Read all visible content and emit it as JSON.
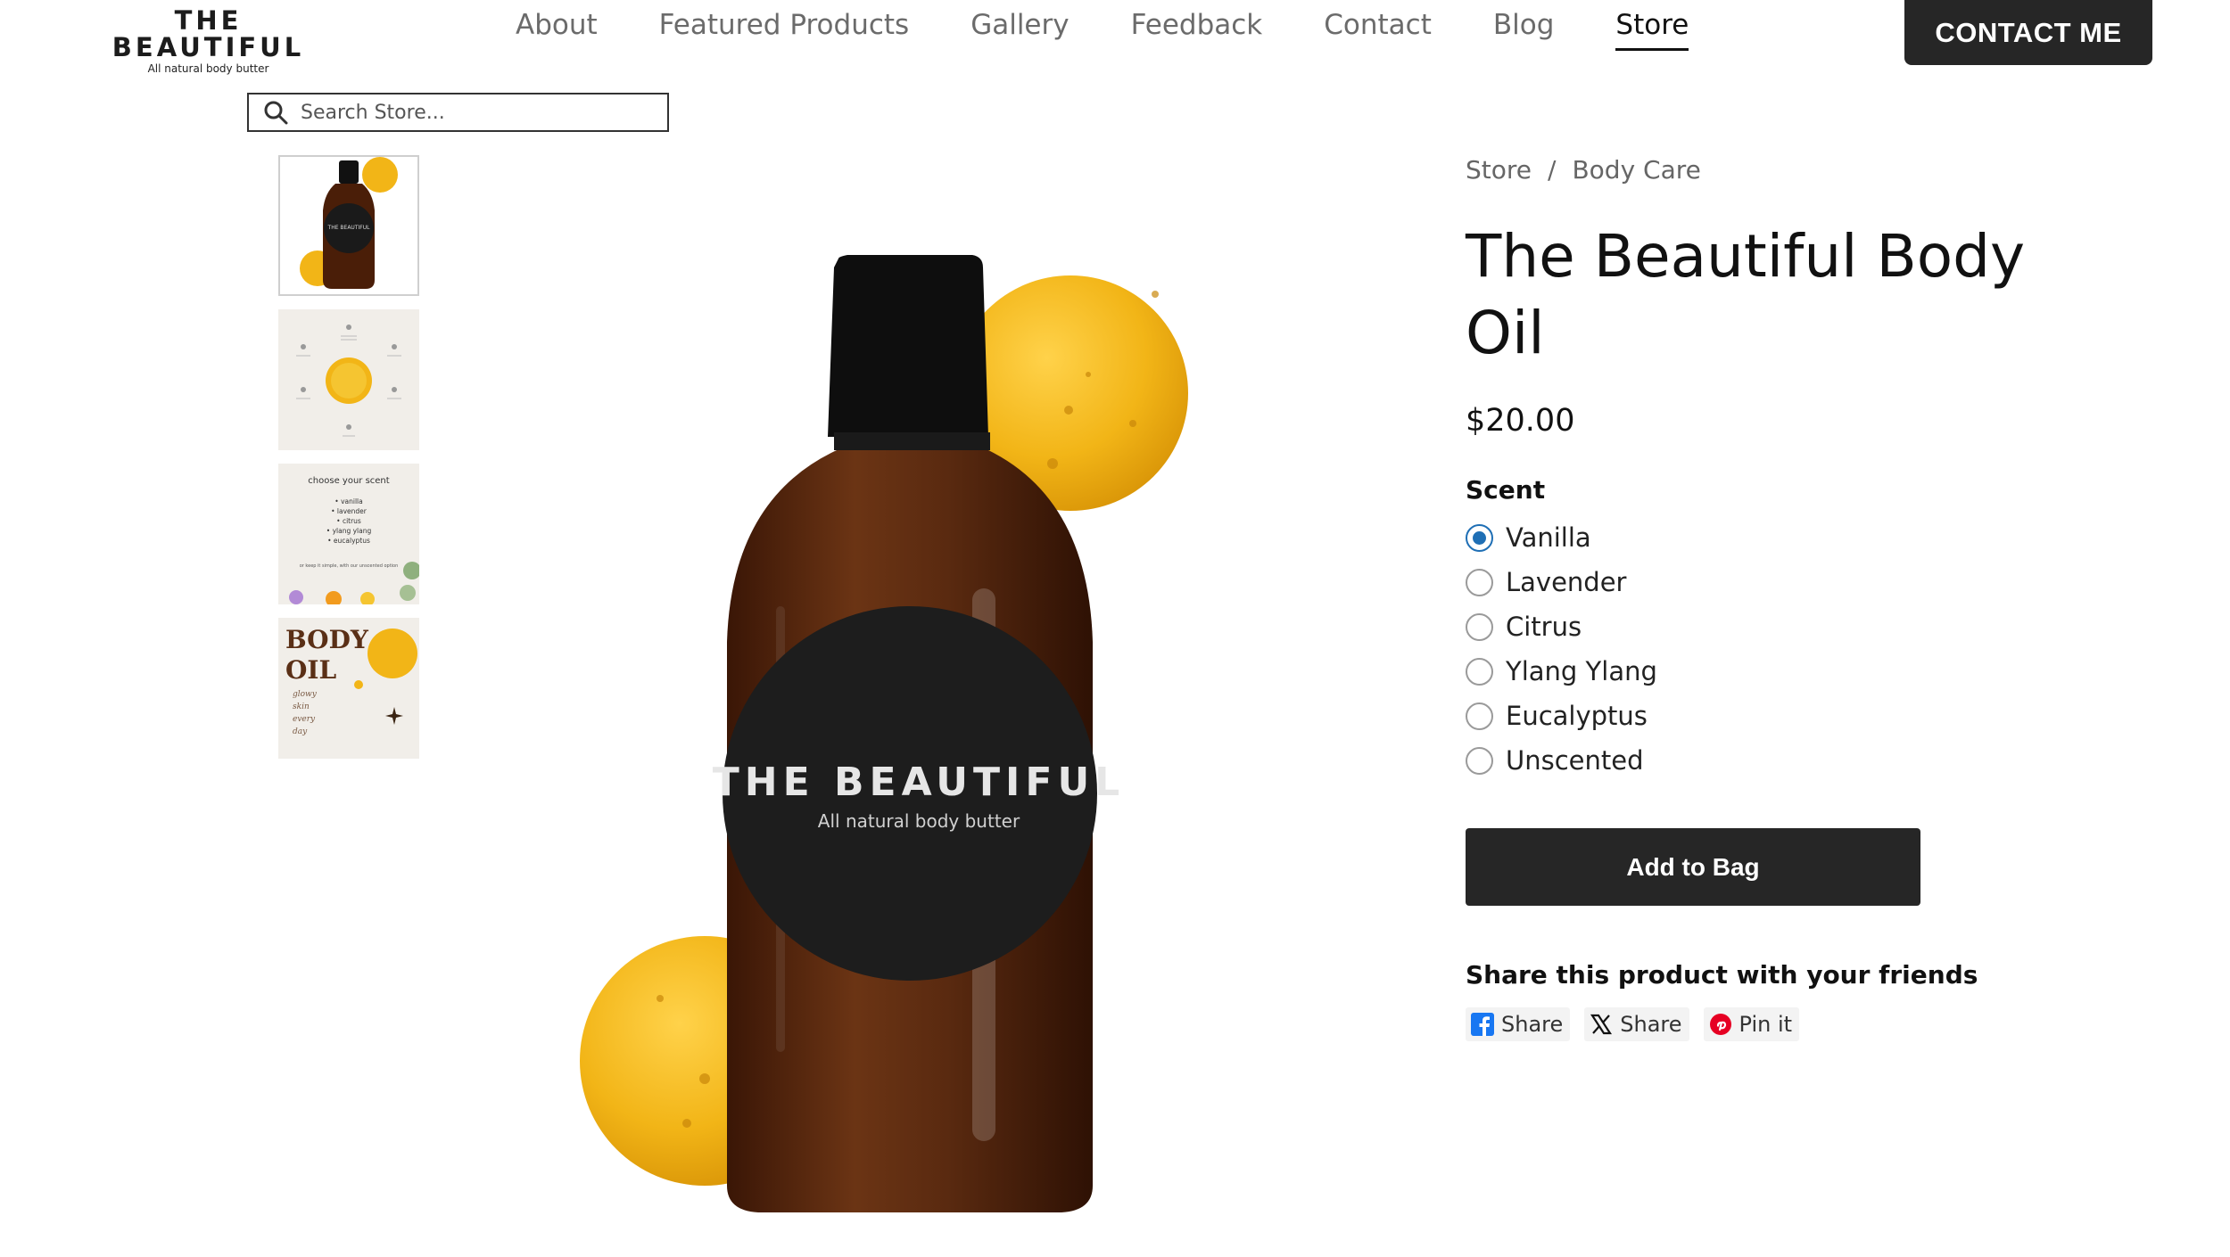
{
  "header": {
    "logo_title": "THE BEAUTIFUL",
    "logo_subtitle": "All natural body butter",
    "nav": [
      {
        "label": "About"
      },
      {
        "label": "Featured Products"
      },
      {
        "label": "Gallery"
      },
      {
        "label": "Feedback"
      },
      {
        "label": "Contact"
      },
      {
        "label": "Blog"
      },
      {
        "label": "Store",
        "active": true
      }
    ],
    "contact_button": "CONTACT ME"
  },
  "search": {
    "placeholder": "Search Store..."
  },
  "thumbnails": {
    "items": [
      {
        "label": "product-bottle-photo",
        "selected": true
      },
      {
        "label": "benefits-infographic"
      },
      {
        "label": "scent-options-card",
        "heading": "choose your scent",
        "lines": [
          "• vanilla",
          "• lavender",
          "• citrus",
          "• ylang ylang",
          "• eucalyptus"
        ],
        "footer": "or keep it simple, with our unscented option"
      },
      {
        "label": "body-oil-card",
        "line1": "BODY",
        "line2": "OIL",
        "tagline": [
          "glowy",
          "skin",
          "every",
          "day"
        ]
      }
    ]
  },
  "product_image": {
    "label_title": "THE BEAUTIFUL",
    "label_subtitle": "All natural body butter"
  },
  "product": {
    "breadcrumb": [
      "Store",
      "Body Care"
    ],
    "breadcrumb_separator": "/",
    "title": "The Beautiful Body Oil",
    "price": "$20.00",
    "scent_label": "Scent",
    "scents": [
      {
        "label": "Vanilla",
        "checked": true
      },
      {
        "label": "Lavender"
      },
      {
        "label": "Citrus"
      },
      {
        "label": "Ylang Ylang"
      },
      {
        "label": "Eucalyptus"
      },
      {
        "label": "Unscented"
      }
    ],
    "add_button": "Add to Bag"
  },
  "share": {
    "title": "Share this product with your friends",
    "buttons": [
      {
        "network": "facebook",
        "label": "Share",
        "icon": "facebook-icon"
      },
      {
        "network": "x",
        "label": "Share",
        "icon": "x-icon"
      },
      {
        "network": "pinterest",
        "label": "Pin it",
        "icon": "pinterest-icon"
      }
    ]
  },
  "colors": {
    "dark_button": "#262626",
    "radio_accent": "#1f6fb5",
    "bottle_amber": "#5a2a10",
    "oil_gold": "#f2b517"
  }
}
